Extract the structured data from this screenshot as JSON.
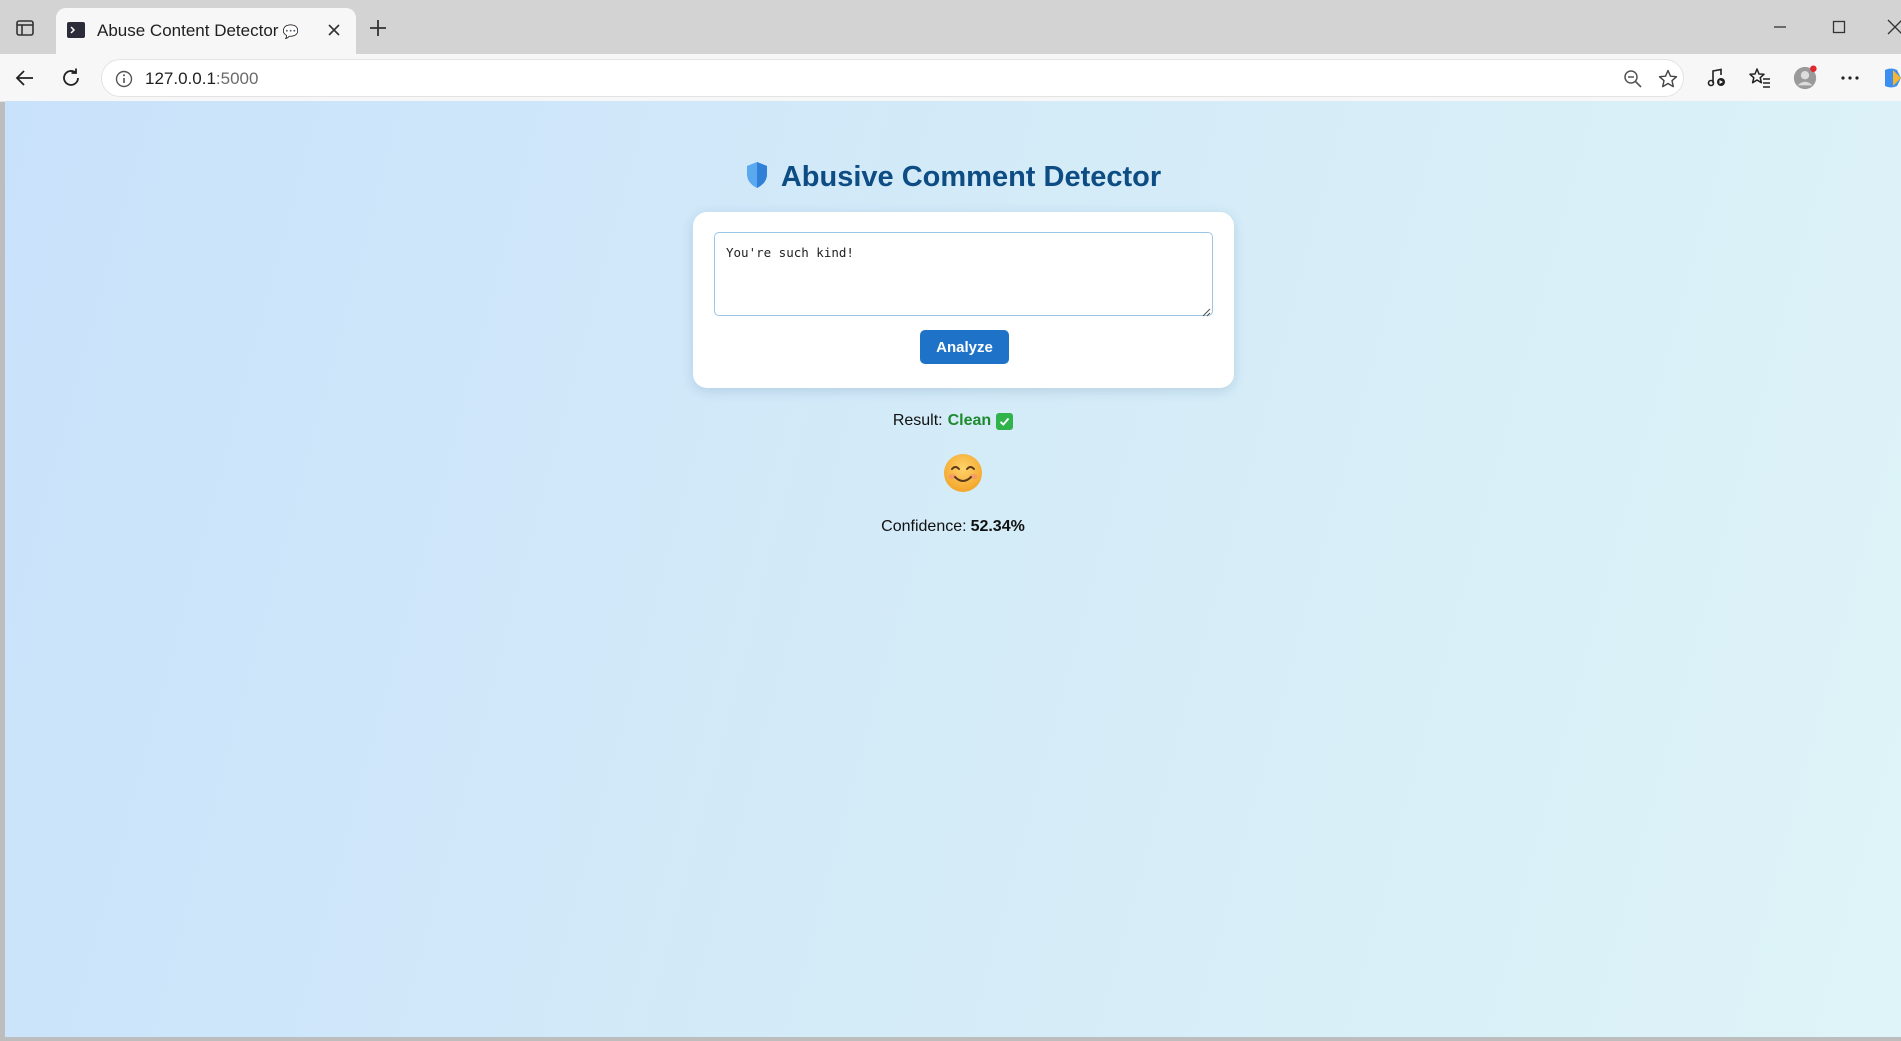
{
  "browser": {
    "tab": {
      "title": "Abuse Content Detector",
      "title_emoji": "💬"
    },
    "address_bar": {
      "host": "127.0.0.1",
      "port": ":5000"
    }
  },
  "page": {
    "heading": "Abusive Comment Detector",
    "comment_input": {
      "value": "You're such kind!"
    },
    "analyze_label": "Analyze",
    "result": {
      "label": "Result:",
      "value": "Clean",
      "value_color": "#1e8a2e"
    },
    "confidence": {
      "label": "Confidence:",
      "value": "52.34%"
    },
    "colors": {
      "heading": "#0d4d84",
      "button": "#1e73c9",
      "background_start": "#c9e2fb",
      "background_end": "#def4f8"
    }
  }
}
